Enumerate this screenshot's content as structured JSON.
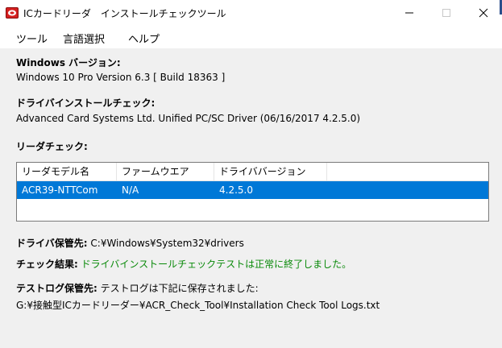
{
  "window": {
    "title": "ICカードリーダ　インストールチェックツール",
    "app_icon": "acr-card-reader-icon",
    "controls": {
      "minimize": "—",
      "maximize": "□",
      "close": "✕"
    }
  },
  "menu": {
    "items": [
      "ツール",
      "言語選択",
      "ヘルプ"
    ]
  },
  "windows_version": {
    "label": "Windows バージョン:",
    "value": "Windows 10 Pro Version 6.3 [ Build 18363 ]"
  },
  "driver_install_check": {
    "label": "ドライバインストールチェック:",
    "value": "Advanced Card Systems Ltd. Unified PC/SC Driver (06/16/2017 4.2.5.0)"
  },
  "reader_check": {
    "label": "リーダチェック:",
    "columns": [
      "リーダモデル名",
      "ファームウエア",
      "ドライババージョン"
    ],
    "rows": [
      {
        "model": "ACR39-NTTCom",
        "firmware": "N/A",
        "driver_version": "4.2.5.0",
        "selected": true
      }
    ]
  },
  "driver_store": {
    "label": "ドライバ保管先:",
    "value": "C:¥Windows¥System32¥drivers"
  },
  "check_result": {
    "label": "チェック結果:",
    "value": "ドライバインストールチェックテストは正常に終了しました。",
    "color": "#0a8a0a"
  },
  "test_log": {
    "label": "テストログ保管先:",
    "message": "テストログは下記に保存されました:",
    "path": "G:¥接触型ICカードリーダー¥ACR_Check_Tool¥Installation Check Tool Logs.txt"
  },
  "colors": {
    "selection": "#0078d7",
    "background": "#f0f0f0",
    "success_text": "#0a8a0a"
  }
}
